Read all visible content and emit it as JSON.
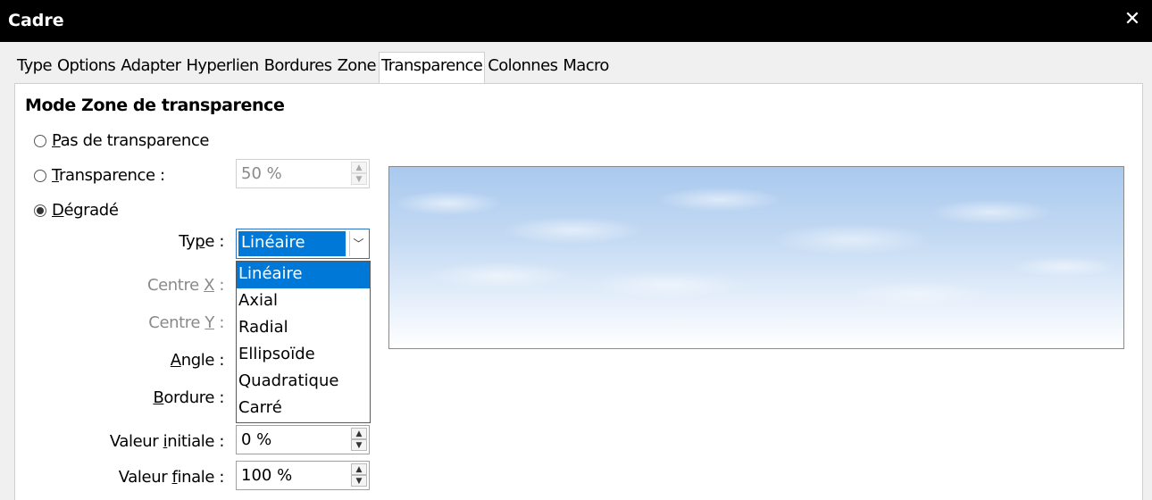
{
  "window": {
    "title": "Cadre",
    "close_symbol": "✕"
  },
  "tabs": [
    {
      "label": "Type"
    },
    {
      "label": "Options"
    },
    {
      "label": "Adapter"
    },
    {
      "label": "Hyperlien"
    },
    {
      "label": "Bordures"
    },
    {
      "label": "Zone"
    },
    {
      "label": "Transparence",
      "active": true
    },
    {
      "label": "Colonnes"
    },
    {
      "label": "Macro"
    }
  ],
  "panel": {
    "section_title": "Mode Zone de transparence",
    "radios": {
      "none": {
        "mnemonic": "P",
        "rest": "as de transparence",
        "checked": false
      },
      "transparency": {
        "mnemonic": "T",
        "rest": "ransparence :",
        "checked": false
      },
      "gradient": {
        "mnemonic": "D",
        "rest": "égradé",
        "checked": true
      }
    },
    "transparency_value": "50 %",
    "type": {
      "label_pre": "Ty",
      "label_mn": "p",
      "label_post": "e :",
      "selected": "Linéaire",
      "options": [
        "Linéaire",
        "Axial",
        "Radial",
        "Ellipsoïde",
        "Quadratique",
        "Carré"
      ],
      "highlighted_index": 0
    },
    "center_x": {
      "label_pre": "Centre ",
      "label_mn": "X",
      "label_post": " :"
    },
    "center_y": {
      "label_pre": "Centre ",
      "label_mn": "Y",
      "label_post": " :"
    },
    "angle": {
      "label_mn": "A",
      "label_post": "ngle :"
    },
    "border": {
      "label_mn": "B",
      "label_post": "ordure :"
    },
    "start_value": {
      "label_pre": "Valeur ",
      "label_mn": "i",
      "label_post": "nitiale :",
      "value": "0 %"
    },
    "end_value": {
      "label_pre": "Valeur ",
      "label_mn": "f",
      "label_post": "inale :",
      "value": "100 %"
    }
  },
  "colors": {
    "accent": "#0078d7",
    "titlebar": "#000000",
    "dialog_bg": "#f0f0f0"
  }
}
